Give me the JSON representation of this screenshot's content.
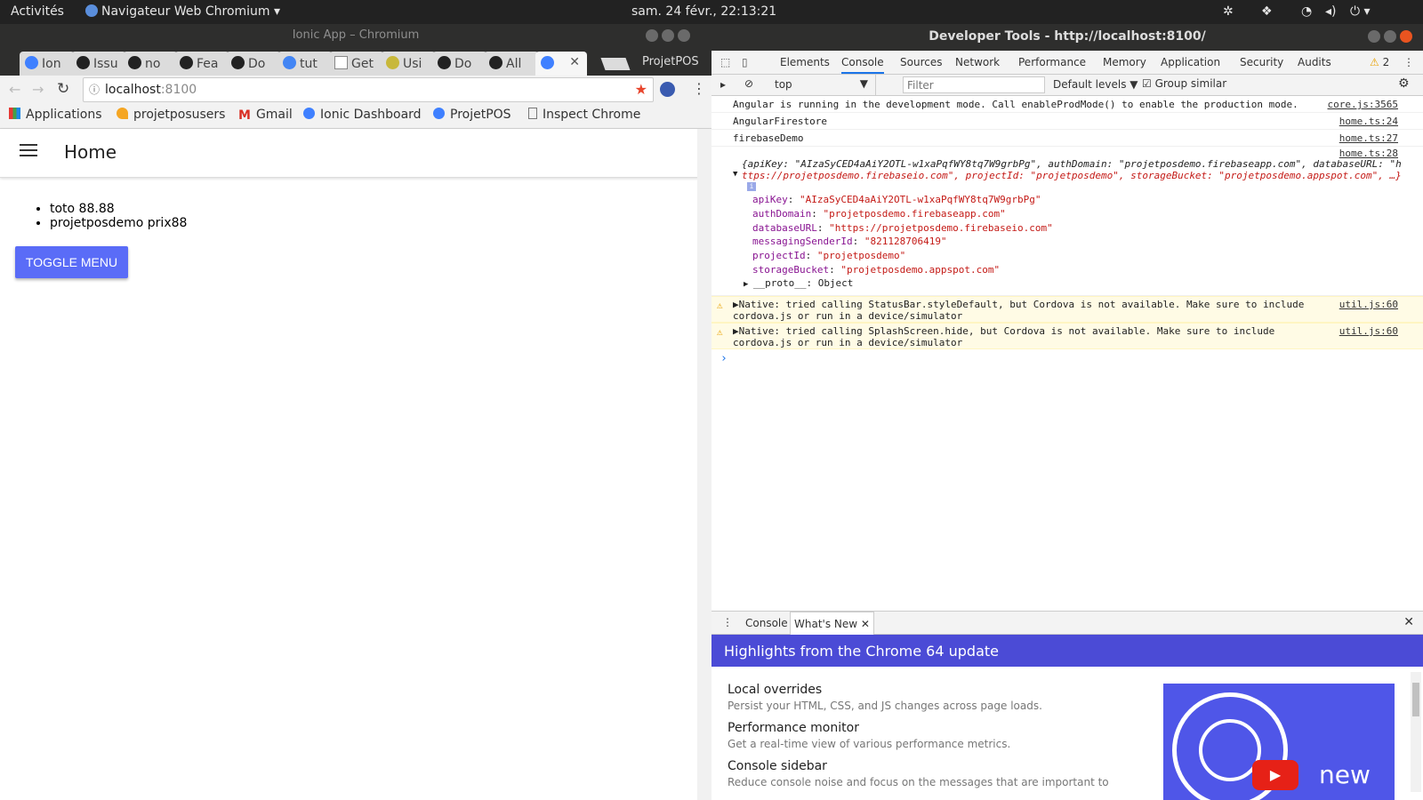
{
  "topbar": {
    "activities": "Activités",
    "app_menu": "Navigateur Web Chromium",
    "clock": "sam. 24 févr., 22:13:21"
  },
  "chromium": {
    "window_title": "Ionic App – Chromium",
    "tabs": [
      "Ion",
      "Issu",
      "no",
      "Fea",
      "Do",
      "tut",
      "Get",
      "Usi",
      "Do",
      "All",
      ""
    ],
    "profile": "ProjetPOS",
    "url_host": "localhost",
    "url_port": ":8100",
    "bookmarks": [
      "Applications",
      "projetposusers",
      "Gmail",
      "Ionic Dashboard",
      "ProjetPOS",
      "Inspect Chrome"
    ]
  },
  "app": {
    "title": "Home",
    "items": [
      "toto 88.88",
      "projetposdemo prix88"
    ],
    "toggle_label": "TOGGLE MENU",
    "accent": "#5a6cf7"
  },
  "devtools": {
    "title": "Developer Tools - http://localhost:8100/",
    "tabs": [
      "Elements",
      "Console",
      "Sources",
      "Network",
      "Performance",
      "Memory",
      "Application",
      "Security",
      "Audits"
    ],
    "warning_count": "2",
    "context": "top",
    "filter_placeholder": "Filter",
    "levels": "Default levels",
    "group_similar": "Group similar",
    "messages": [
      {
        "text": "Angular is running in the development mode. Call enableProdMode() to enable the production mode.",
        "src": "core.js:3565"
      },
      {
        "text": "AngularFirestore",
        "src": "home.ts:24"
      },
      {
        "text": "firebaseDemo",
        "src": "home.ts:27"
      }
    ],
    "object_src": "home.ts:28",
    "object_summary_1": "{apiKey: \"AIzaSyCED4aAiY2OTL-w1xaPqfWY8tq7W9grbPg\", authDomain: \"projetposdemo.firebaseapp.com\", databaseURL: \"h",
    "object_summary_2": "ttps://projetposdemo.firebaseio.com\", projectId: \"projetposdemo\", storageBucket: \"projetposdemo.appspot.com\", …}",
    "props": [
      {
        "k": "apiKey",
        "v": "\"AIzaSyCED4aAiY2OTL-w1xaPqfWY8tq7W9grbPg\""
      },
      {
        "k": "authDomain",
        "v": "\"projetposdemo.firebaseapp.com\""
      },
      {
        "k": "databaseURL",
        "v": "\"https://projetposdemo.firebaseio.com\""
      },
      {
        "k": "messagingSenderId",
        "v": "\"821128706419\""
      },
      {
        "k": "projectId",
        "v": "\"projetposdemo\""
      },
      {
        "k": "storageBucket",
        "v": "\"projetposdemo.appspot.com\""
      }
    ],
    "proto": "__proto__: Object",
    "warnings": [
      {
        "l1": "Native: tried calling StatusBar.styleDefault, but Cordova is not available. Make sure to include",
        "l2": "cordova.js or run in a device/simulator",
        "src": "util.js:60"
      },
      {
        "l1": "Native: tried calling SplashScreen.hide, but Cordova is not available. Make sure to include",
        "l2": "cordova.js or run in a device/simulator",
        "src": "util.js:60"
      }
    ],
    "drawer_tabs": [
      "Console",
      "What's New"
    ],
    "whatsnew_title": "Highlights from the Chrome 64 update",
    "whatsnew_items": [
      {
        "t": "Local overrides",
        "d": "Persist your HTML, CSS, and JS changes across page loads."
      },
      {
        "t": "Performance monitor",
        "d": "Get a real-time view of various performance metrics."
      },
      {
        "t": "Console sidebar",
        "d": "Reduce console noise and focus on the messages that are important to"
      }
    ],
    "video_word": "new"
  }
}
